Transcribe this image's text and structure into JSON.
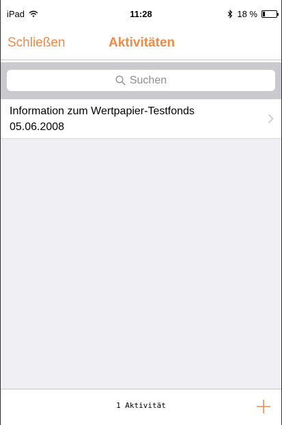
{
  "status_bar": {
    "device": "iPad",
    "time": "11:28",
    "battery_percent_text": "18 %",
    "battery_level": 0.18,
    "icons": [
      "wifi-icon",
      "bluetooth-icon",
      "battery-icon"
    ]
  },
  "nav": {
    "close_label": "Schließen",
    "title": "Aktivitäten",
    "accent_color": "#f08a46"
  },
  "search": {
    "placeholder": "Suchen",
    "icon": "search-icon"
  },
  "list": {
    "items": [
      {
        "title": "Information zum Wertpapier-Testfonds",
        "date": "05.06.2008",
        "accessory_icon": "chevron-right-icon"
      }
    ]
  },
  "toolbar": {
    "count_label": "1 Aktivität",
    "add_icon": "plus-icon"
  }
}
